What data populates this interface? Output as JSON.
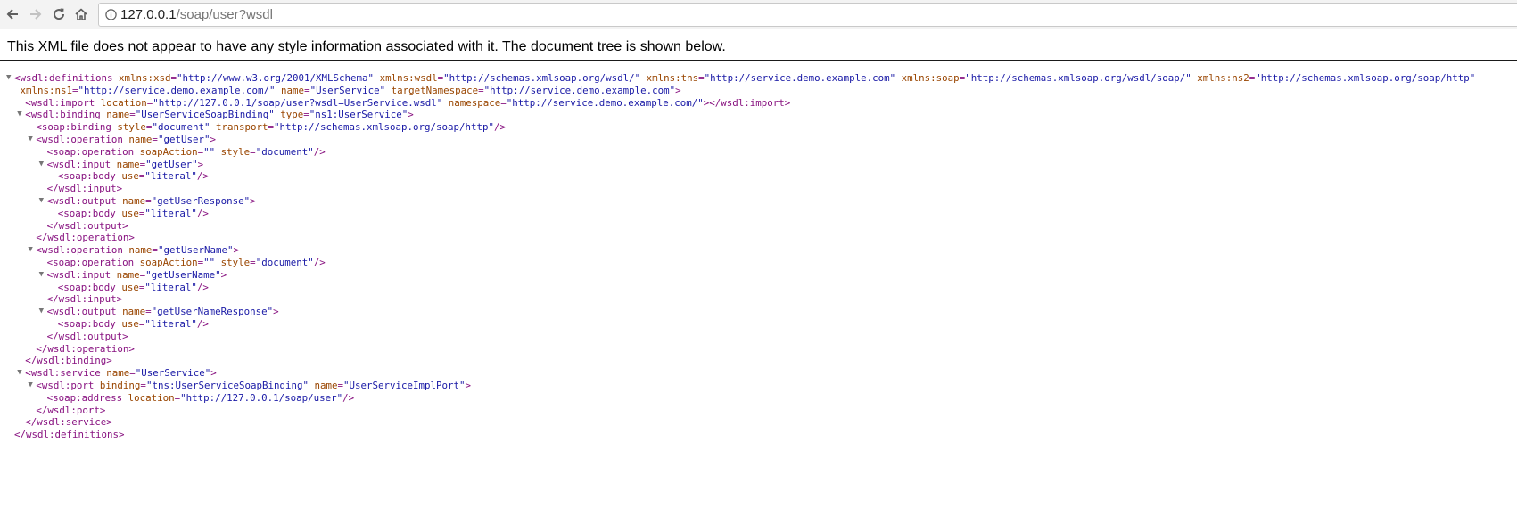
{
  "browser": {
    "url_host": "127.0.0.1",
    "url_path": "/soap/user?wsdl",
    "icons": {
      "back": "back-arrow-icon",
      "forward": "forward-arrow-icon",
      "reload": "reload-icon",
      "home": "home-icon",
      "info": "info-icon"
    }
  },
  "page": {
    "notice": "This XML file does not appear to have any style information associated with it. The document tree is shown below."
  },
  "xml": {
    "lines": [
      {
        "indent": 0,
        "toggle": true,
        "parts": [
          [
            "t",
            "<wsdl:definitions"
          ],
          [
            "n",
            "xmlns:xsd"
          ],
          [
            "t",
            "="
          ],
          [
            "v",
            "\"http://www.w3.org/2001/XMLSchema\""
          ],
          [
            "n",
            "xmlns:wsdl"
          ],
          [
            "t",
            "="
          ],
          [
            "v",
            "\"http://schemas.xmlsoap.org/wsdl/\""
          ],
          [
            "n",
            "xmlns:tns"
          ],
          [
            "t",
            "="
          ],
          [
            "v",
            "\"http://service.demo.example.com\""
          ],
          [
            "n",
            "xmlns:soap"
          ],
          [
            "t",
            "="
          ],
          [
            "v",
            "\"http://schemas.xmlsoap.org/wsdl/soap/\""
          ],
          [
            "n",
            "xmlns:ns2"
          ],
          [
            "t",
            "="
          ],
          [
            "v",
            "\"http://schemas.xmlsoap.org/soap/http\""
          ]
        ]
      },
      {
        "indent": 0,
        "toggle": false,
        "parts": [
          [
            "n",
            "xmlns:ns1"
          ],
          [
            "t",
            "="
          ],
          [
            "v",
            "\"http://service.demo.example.com/\""
          ],
          [
            "n",
            "name"
          ],
          [
            "t",
            "="
          ],
          [
            "v",
            "\"UserService\""
          ],
          [
            "n",
            "targetNamespace"
          ],
          [
            "t",
            "="
          ],
          [
            "v",
            "\"http://service.demo.example.com\""
          ],
          [
            "t",
            ">"
          ]
        ]
      },
      {
        "indent": 1,
        "toggle": false,
        "parts": [
          [
            "t",
            "<wsdl:import"
          ],
          [
            "n",
            "location"
          ],
          [
            "t",
            "="
          ],
          [
            "v",
            "\"http://127.0.0.1/soap/user?wsdl=UserService.wsdl\""
          ],
          [
            "n",
            "namespace"
          ],
          [
            "t",
            "="
          ],
          [
            "v",
            "\"http://service.demo.example.com/\""
          ],
          [
            "t",
            "></wsdl:import>"
          ]
        ]
      },
      {
        "indent": 1,
        "toggle": true,
        "parts": [
          [
            "t",
            "<wsdl:binding"
          ],
          [
            "n",
            "name"
          ],
          [
            "t",
            "="
          ],
          [
            "v",
            "\"UserServiceSoapBinding\""
          ],
          [
            "n",
            "type"
          ],
          [
            "t",
            "="
          ],
          [
            "v",
            "\"ns1:UserService\""
          ],
          [
            "t",
            ">"
          ]
        ]
      },
      {
        "indent": 2,
        "toggle": false,
        "parts": [
          [
            "t",
            "<soap:binding"
          ],
          [
            "n",
            "style"
          ],
          [
            "t",
            "="
          ],
          [
            "v",
            "\"document\""
          ],
          [
            "n",
            "transport"
          ],
          [
            "t",
            "="
          ],
          [
            "v",
            "\"http://schemas.xmlsoap.org/soap/http\""
          ],
          [
            "t",
            "/>"
          ]
        ]
      },
      {
        "indent": 2,
        "toggle": true,
        "parts": [
          [
            "t",
            "<wsdl:operation"
          ],
          [
            "n",
            "name"
          ],
          [
            "t",
            "="
          ],
          [
            "v",
            "\"getUser\""
          ],
          [
            "t",
            ">"
          ]
        ]
      },
      {
        "indent": 3,
        "toggle": false,
        "parts": [
          [
            "t",
            "<soap:operation"
          ],
          [
            "n",
            "soapAction"
          ],
          [
            "t",
            "="
          ],
          [
            "v",
            "\"\""
          ],
          [
            "n",
            "style"
          ],
          [
            "t",
            "="
          ],
          [
            "v",
            "\"document\""
          ],
          [
            "t",
            "/>"
          ]
        ]
      },
      {
        "indent": 3,
        "toggle": true,
        "parts": [
          [
            "t",
            "<wsdl:input"
          ],
          [
            "n",
            "name"
          ],
          [
            "t",
            "="
          ],
          [
            "v",
            "\"getUser\""
          ],
          [
            "t",
            ">"
          ]
        ]
      },
      {
        "indent": 4,
        "toggle": false,
        "parts": [
          [
            "t",
            "<soap:body"
          ],
          [
            "n",
            "use"
          ],
          [
            "t",
            "="
          ],
          [
            "v",
            "\"literal\""
          ],
          [
            "t",
            "/>"
          ]
        ]
      },
      {
        "indent": 3,
        "toggle": false,
        "parts": [
          [
            "t",
            "</wsdl:input>"
          ]
        ]
      },
      {
        "indent": 3,
        "toggle": true,
        "parts": [
          [
            "t",
            "<wsdl:output"
          ],
          [
            "n",
            "name"
          ],
          [
            "t",
            "="
          ],
          [
            "v",
            "\"getUserResponse\""
          ],
          [
            "t",
            ">"
          ]
        ]
      },
      {
        "indent": 4,
        "toggle": false,
        "parts": [
          [
            "t",
            "<soap:body"
          ],
          [
            "n",
            "use"
          ],
          [
            "t",
            "="
          ],
          [
            "v",
            "\"literal\""
          ],
          [
            "t",
            "/>"
          ]
        ]
      },
      {
        "indent": 3,
        "toggle": false,
        "parts": [
          [
            "t",
            "</wsdl:output>"
          ]
        ]
      },
      {
        "indent": 2,
        "toggle": false,
        "parts": [
          [
            "t",
            "</wsdl:operation>"
          ]
        ]
      },
      {
        "indent": 2,
        "toggle": true,
        "parts": [
          [
            "t",
            "<wsdl:operation"
          ],
          [
            "n",
            "name"
          ],
          [
            "t",
            "="
          ],
          [
            "v",
            "\"getUserName\""
          ],
          [
            "t",
            ">"
          ]
        ]
      },
      {
        "indent": 3,
        "toggle": false,
        "parts": [
          [
            "t",
            "<soap:operation"
          ],
          [
            "n",
            "soapAction"
          ],
          [
            "t",
            "="
          ],
          [
            "v",
            "\"\""
          ],
          [
            "n",
            "style"
          ],
          [
            "t",
            "="
          ],
          [
            "v",
            "\"document\""
          ],
          [
            "t",
            "/>"
          ]
        ]
      },
      {
        "indent": 3,
        "toggle": true,
        "parts": [
          [
            "t",
            "<wsdl:input"
          ],
          [
            "n",
            "name"
          ],
          [
            "t",
            "="
          ],
          [
            "v",
            "\"getUserName\""
          ],
          [
            "t",
            ">"
          ]
        ]
      },
      {
        "indent": 4,
        "toggle": false,
        "parts": [
          [
            "t",
            "<soap:body"
          ],
          [
            "n",
            "use"
          ],
          [
            "t",
            "="
          ],
          [
            "v",
            "\"literal\""
          ],
          [
            "t",
            "/>"
          ]
        ]
      },
      {
        "indent": 3,
        "toggle": false,
        "parts": [
          [
            "t",
            "</wsdl:input>"
          ]
        ]
      },
      {
        "indent": 3,
        "toggle": true,
        "parts": [
          [
            "t",
            "<wsdl:output"
          ],
          [
            "n",
            "name"
          ],
          [
            "t",
            "="
          ],
          [
            "v",
            "\"getUserNameResponse\""
          ],
          [
            "t",
            ">"
          ]
        ]
      },
      {
        "indent": 4,
        "toggle": false,
        "parts": [
          [
            "t",
            "<soap:body"
          ],
          [
            "n",
            "use"
          ],
          [
            "t",
            "="
          ],
          [
            "v",
            "\"literal\""
          ],
          [
            "t",
            "/>"
          ]
        ]
      },
      {
        "indent": 3,
        "toggle": false,
        "parts": [
          [
            "t",
            "</wsdl:output>"
          ]
        ]
      },
      {
        "indent": 2,
        "toggle": false,
        "parts": [
          [
            "t",
            "</wsdl:operation>"
          ]
        ]
      },
      {
        "indent": 1,
        "toggle": false,
        "parts": [
          [
            "t",
            "</wsdl:binding>"
          ]
        ]
      },
      {
        "indent": 1,
        "toggle": true,
        "parts": [
          [
            "t",
            "<wsdl:service"
          ],
          [
            "n",
            "name"
          ],
          [
            "t",
            "="
          ],
          [
            "v",
            "\"UserService\""
          ],
          [
            "t",
            ">"
          ]
        ]
      },
      {
        "indent": 2,
        "toggle": true,
        "parts": [
          [
            "t",
            "<wsdl:port"
          ],
          [
            "n",
            "binding"
          ],
          [
            "t",
            "="
          ],
          [
            "v",
            "\"tns:UserServiceSoapBinding\""
          ],
          [
            "n",
            "name"
          ],
          [
            "t",
            "="
          ],
          [
            "v",
            "\"UserServiceImplPort\""
          ],
          [
            "t",
            ">"
          ]
        ]
      },
      {
        "indent": 3,
        "toggle": false,
        "parts": [
          [
            "t",
            "<soap:address"
          ],
          [
            "n",
            "location"
          ],
          [
            "t",
            "="
          ],
          [
            "v",
            "\"http://127.0.0.1/soap/user\""
          ],
          [
            "t",
            "/>"
          ]
        ]
      },
      {
        "indent": 2,
        "toggle": false,
        "parts": [
          [
            "t",
            "</wsdl:port>"
          ]
        ]
      },
      {
        "indent": 1,
        "toggle": false,
        "parts": [
          [
            "t",
            "</wsdl:service>"
          ]
        ]
      },
      {
        "indent": 0,
        "toggle": false,
        "parts": [
          [
            "t",
            "</wsdl:definitions>"
          ]
        ]
      }
    ]
  }
}
